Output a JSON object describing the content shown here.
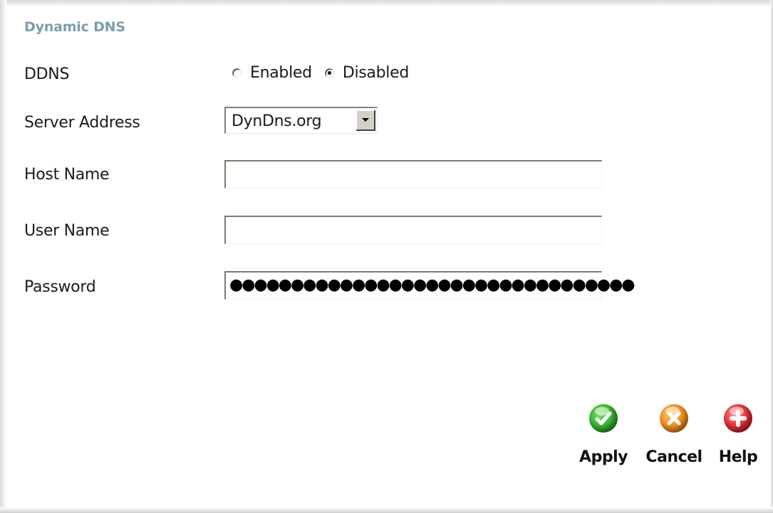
{
  "section": {
    "title": "Dynamic DNS"
  },
  "ddns": {
    "label": "DDNS",
    "options": [
      {
        "label": "Enabled",
        "checked": false
      },
      {
        "label": "Disabled",
        "checked": true
      }
    ]
  },
  "server_address": {
    "label": "Server Address",
    "selected": "DynDns.org"
  },
  "host_name": {
    "label": "Host Name",
    "value": ""
  },
  "user_name": {
    "label": "User Name",
    "value": ""
  },
  "password": {
    "label": "Password",
    "masked": "●●●●●●●●●●●●●●●●●●●●●●●●●●●●●●●●●"
  },
  "actions": {
    "apply": {
      "label": "Apply",
      "icon": "check-icon",
      "color": "#2fae2a"
    },
    "cancel": {
      "label": "Cancel",
      "icon": "x-icon",
      "color": "#f08c1a"
    },
    "help": {
      "label": "Help",
      "icon": "plus-icon",
      "color": "#e2262a"
    }
  }
}
